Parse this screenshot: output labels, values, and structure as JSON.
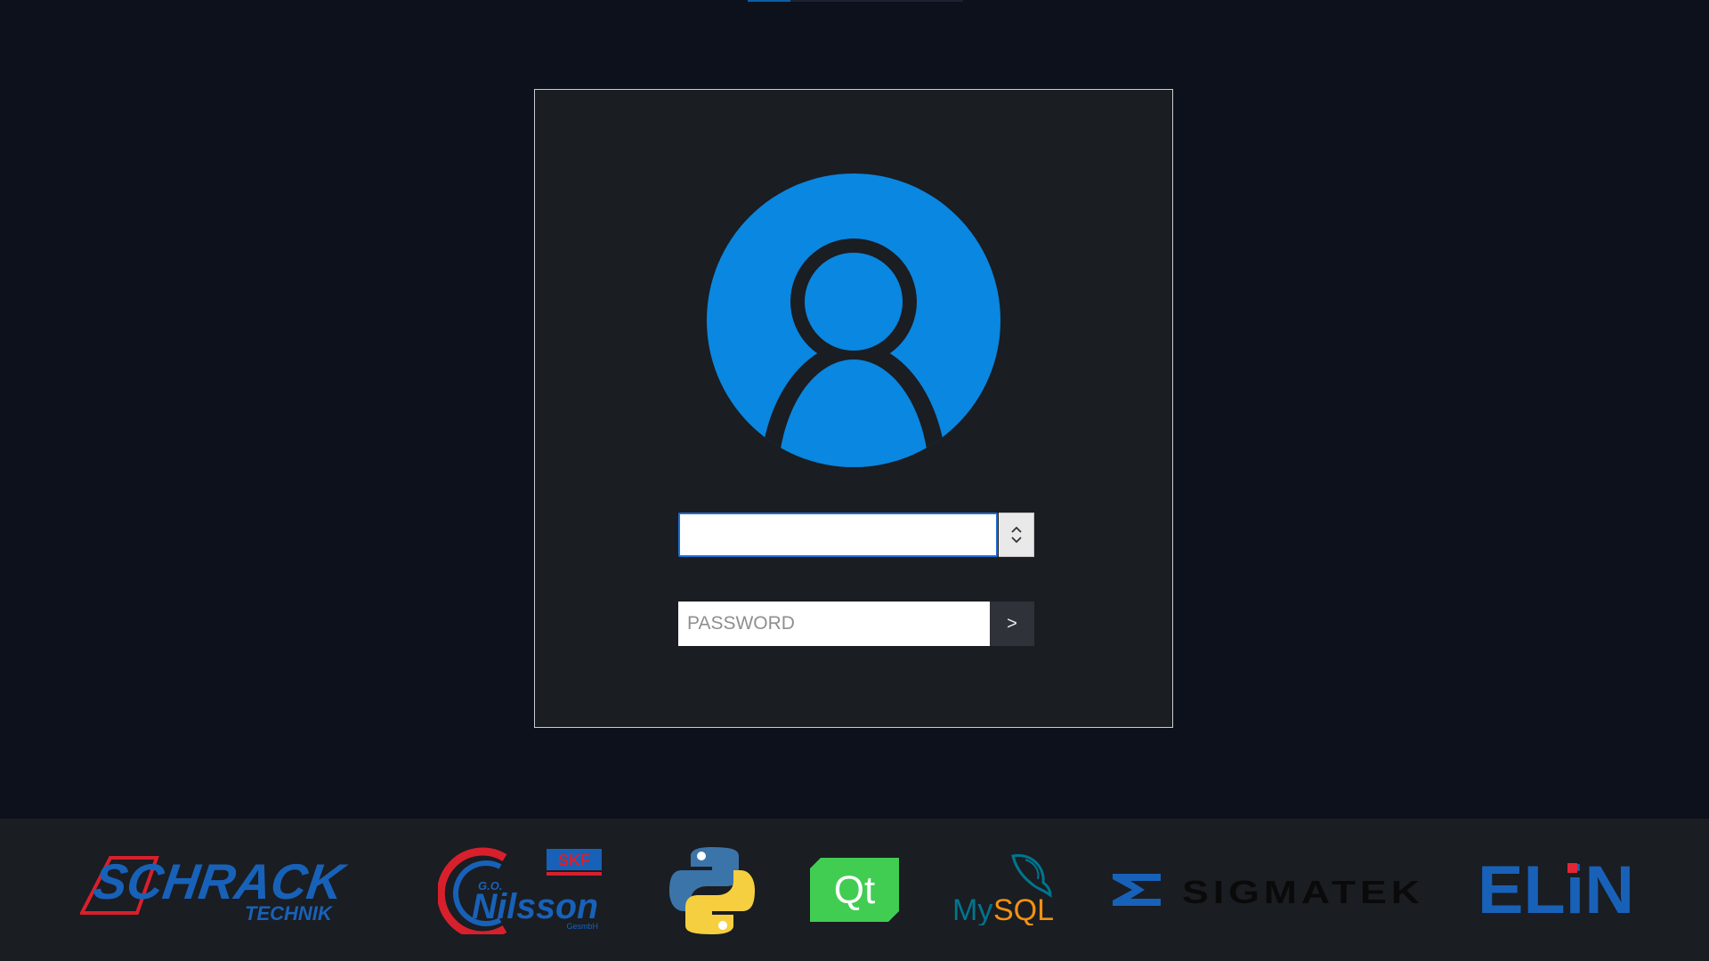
{
  "login": {
    "username_value": "",
    "username_placeholder": "",
    "password_placeholder": "PASSWORD",
    "submit_label": ">"
  },
  "icons": {
    "avatar": "user-avatar-icon",
    "dropdown": "chevron-up-down-icon"
  },
  "logos": {
    "schrack": {
      "line1": "SCHRACK",
      "line2": "TECHNIK"
    },
    "nilsson": {
      "skf": "SKF",
      "initials": "G.O.",
      "name": "Nilsson",
      "suffix": "GesmbH"
    },
    "python": {},
    "qt": {
      "text": "Qt"
    },
    "mysql": {
      "my": "My",
      "sql": "SQL",
      "tm": "."
    },
    "sigmatek": {
      "text": "SIGMATEK"
    },
    "elin": {
      "text": "ELiN"
    }
  },
  "colors": {
    "background": "#0c111b",
    "panel": "#1a1d22",
    "accent": "#0a87e0",
    "focus_border": "#1c6fd6"
  }
}
